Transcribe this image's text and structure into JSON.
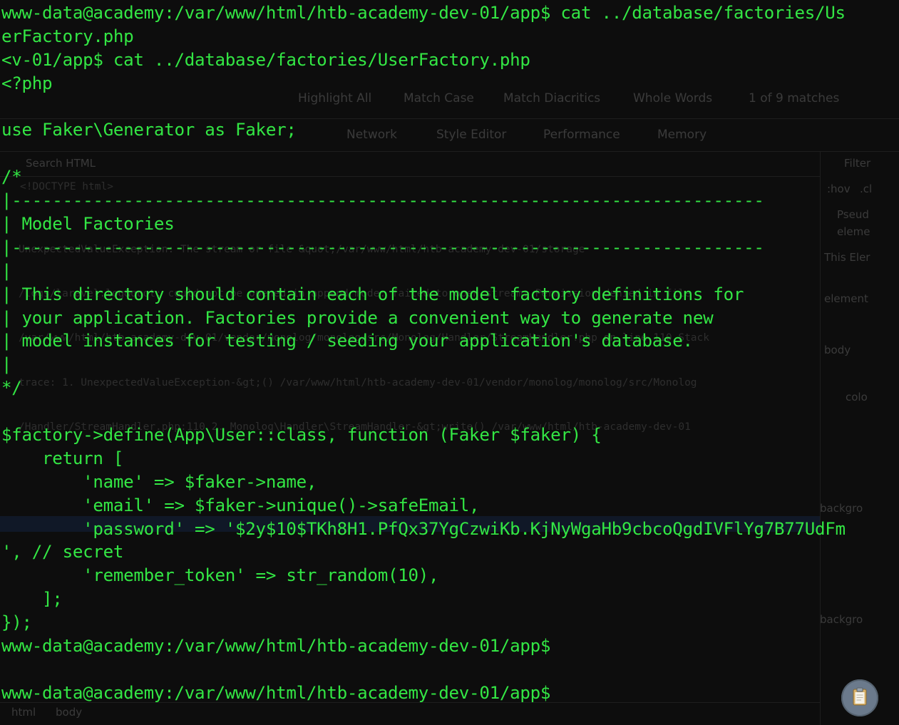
{
  "terminal": {
    "lines": [
      "www-data@academy:/var/www/html/htb-academy-dev-01/app$ cat ../database/factories/Us",
      "erFactory.php",
      "<v-01/app$ cat ../database/factories/UserFactory.php",
      "<?php",
      "",
      "use Faker\\Generator as Faker;",
      "",
      "/*",
      "|--------------------------------------------------------------------------",
      "| Model Factories",
      "|--------------------------------------------------------------------------",
      "|",
      "| This directory should contain each of the model factory definitions for",
      "| your application. Factories provide a convenient way to generate new",
      "| model instances for testing / seeding your application's database.",
      "|",
      "*/",
      "",
      "$factory->define(App\\User::class, function (Faker $faker) {",
      "    return [",
      "        'name' => $faker->name,",
      "        'email' => $faker->unique()->safeEmail,",
      "        'password' => '$2y$10$TKh8H1.PfQx37YgCzwiKb.KjNyWgaHb9cbcoQgdIVFlYg7B77UdFm",
      "', // secret",
      "        'remember_token' => str_random(10),",
      "    ];",
      "});",
      "www-data@academy:/var/www/html/htb-academy-dev-01/app$",
      "",
      "www-data@academy:/var/www/html/htb-academy-dev-01/app$"
    ]
  },
  "background": {
    "find_bar": {
      "highlight_all": "Highlight All",
      "match_case": "Match Case",
      "match_diacritics": "Match Diacritics",
      "whole_words": "Whole Words",
      "match_count": "1 of 9 matches"
    },
    "devtools_tabs": [
      "Network",
      "Style Editor",
      "Performance",
      "Memory"
    ],
    "search_placeholder": "Search HTML",
    "filter_placeholder": "Filter",
    "rules_hover": ":hov",
    "rules_cls": ".cl",
    "doctype": "<!DOCTYPE html>",
    "error_text": [
      "UnexpectedValueException: The stream or file &quot;/var/www/html/htb-academy-dev-01/storage",
      "/logs/laravel.log&quot; could not be opened in append mode: failed to open stream: Permission denied in file",
      "/var/www/html/htb-academy-dev-01/vendor/monolog/monolog/src/Monolog/Handler/StreamHandler.php on line 110 Stack",
      "trace: 1. UnexpectedValueException-&gt;() /var/www/html/htb-academy-dev-01/vendor/monolog/monolog/src/Monolog",
      "/Handler/StreamHandler.php:110 2. Monolog\\Handler\\StreamHandler-&gt;write() /var/www/html/htb-academy-dev-01"
    ],
    "breadcrumb": [
      "html",
      "body"
    ],
    "side_labels": [
      "Pseud",
      "eleme",
      "This Eler",
      "element",
      "body",
      "colo",
      "backgro",
      "backgro"
    ]
  }
}
